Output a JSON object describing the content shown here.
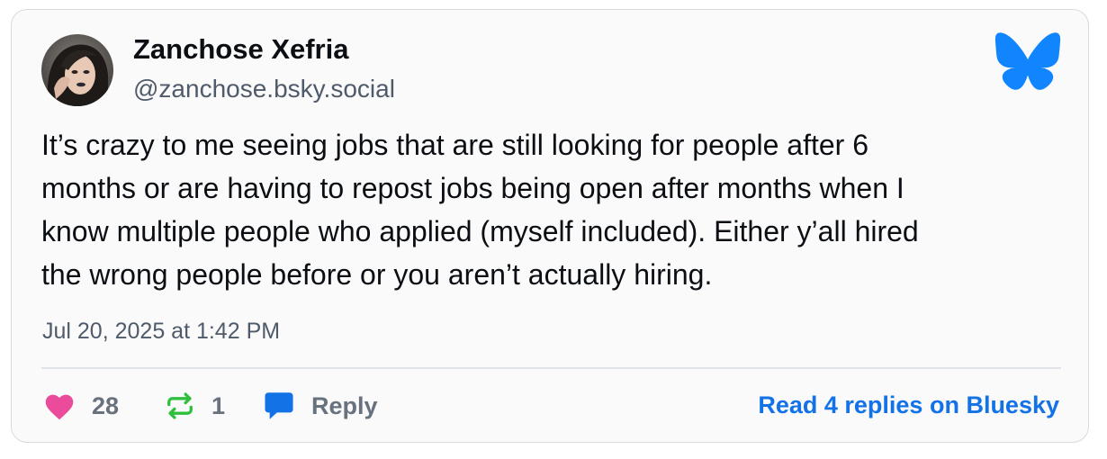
{
  "author": {
    "name": "Zanchose Xefria",
    "handle": "@zanchose.bsky.social"
  },
  "post": {
    "lines": [
      "It’s crazy to me seeing jobs that are still looking for people after 6",
      "months or are having to repost jobs being open after months when I",
      "know multiple people who applied (myself included). Either y’all hired",
      "the wrong people before or you aren’t actually hiring."
    ],
    "timestamp": "Jul 20, 2025 at 1:42 PM"
  },
  "actions": {
    "likes": "28",
    "reposts": "1",
    "reply_label": "Reply",
    "read_replies": "Read 4 replies on Bluesky"
  },
  "icons": {
    "like": "heart-icon",
    "repost": "repost-icon",
    "reply": "speech-bubble-icon",
    "brand": "bluesky-butterfly-icon"
  },
  "colors": {
    "like": "#ea4b9a",
    "repost": "#2fbf3d",
    "reply": "#1372e6",
    "brand": "#1185fe",
    "link": "#1372e6"
  }
}
